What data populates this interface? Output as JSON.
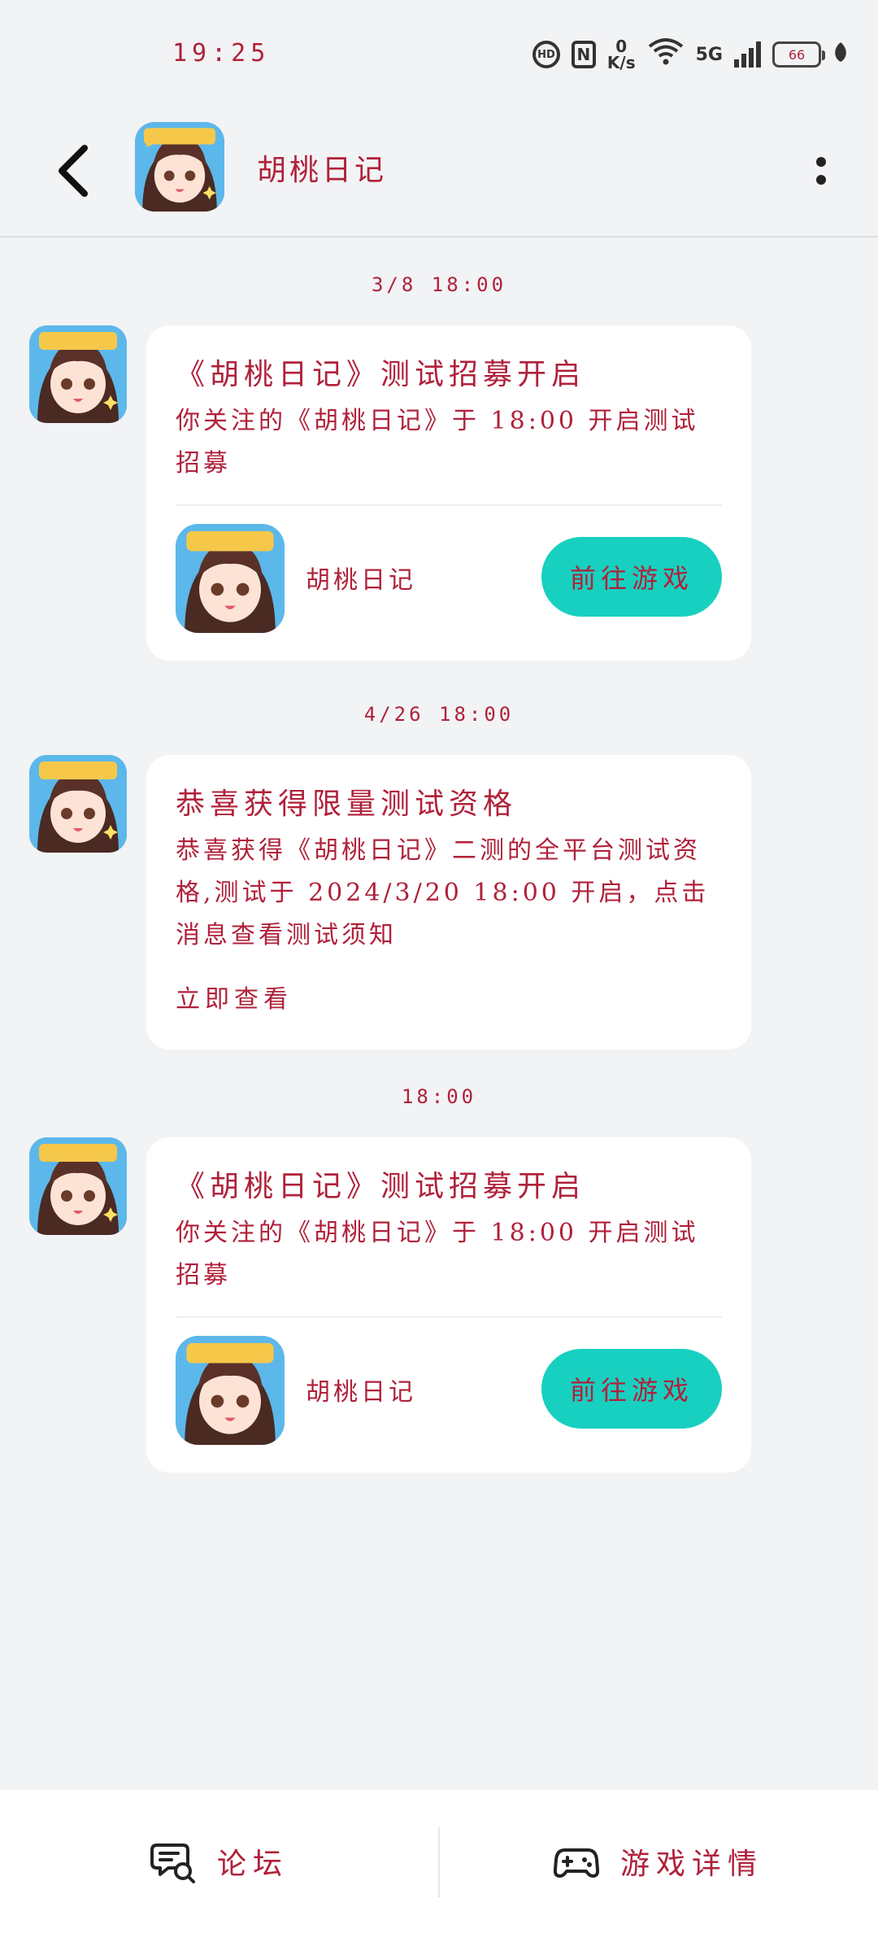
{
  "status_bar": {
    "time": "19:25",
    "speed_value": "0",
    "speed_unit": "K/s",
    "network_type": "5G",
    "battery_level": "66"
  },
  "header": {
    "title": "胡桃日记"
  },
  "messages": [
    {
      "timestamp": "3/8 18:00",
      "title": "《胡桃日记》测试招募开启",
      "body": "你关注的《胡桃日记》于 18:00 开启测试招募",
      "game_name": "胡桃日记",
      "button_label": "前往游戏"
    },
    {
      "timestamp": "4/26 18:00",
      "title": "恭喜获得限量测试资格",
      "body": "恭喜获得《胡桃日记》二测的全平台测试资格,测试于 2024/3/20 18:00 开启，点击消息查看测试须知",
      "link_label": "立即查看"
    },
    {
      "timestamp": "18:00",
      "title": "《胡桃日记》测试招募开启",
      "body": "你关注的《胡桃日记》于 18:00 开启测试招募",
      "game_name": "胡桃日记",
      "button_label": "前往游戏"
    }
  ],
  "bottom_nav": {
    "forum_label": "论坛",
    "game_detail_label": "游戏详情"
  },
  "colors": {
    "accent_text": "#b0213a",
    "button_teal": "#18d0c0",
    "background": "#f2f3f5"
  }
}
